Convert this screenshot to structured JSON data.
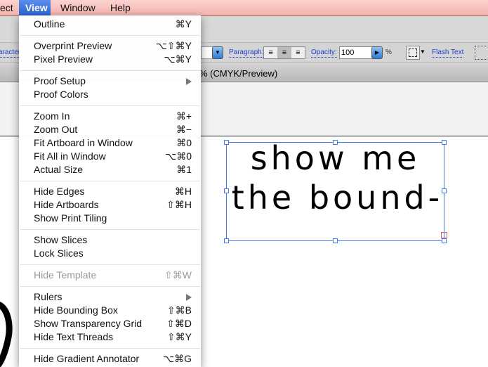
{
  "menubar": {
    "items": [
      "ect",
      "View",
      "Window",
      "Help"
    ],
    "active": "View"
  },
  "controlbar": {
    "character_label": "aracter",
    "paragraph_label": "Paragraph:",
    "opacity_label": "Opacity:",
    "opacity_value": "100",
    "percent": "%",
    "flash_text": "Flash Text"
  },
  "document_tab": {
    "title": "% (CMYK/Preview)"
  },
  "canvas": {
    "text_line1": "show me",
    "text_line2": "the bound-"
  },
  "colors": {
    "accent": "#2c63d6",
    "selection": "#3c7cf0",
    "link": "#1f3fcf"
  },
  "view_menu": {
    "items": [
      {
        "label": "Outline",
        "shortcut": "⌘Y"
      },
      {
        "label": "Overprint Preview",
        "shortcut": "⌥⇧⌘Y"
      },
      {
        "label": "Pixel Preview",
        "shortcut": "⌥⌘Y"
      },
      {
        "label": "Proof Setup",
        "shortcut": "",
        "submenu": true
      },
      {
        "label": "Proof Colors",
        "shortcut": ""
      },
      {
        "label": "Zoom In",
        "shortcut": "⌘+"
      },
      {
        "label": "Zoom Out",
        "shortcut": "⌘−"
      },
      {
        "label": "Fit Artboard in Window",
        "shortcut": "⌘0"
      },
      {
        "label": "Fit All in Window",
        "shortcut": "⌥⌘0"
      },
      {
        "label": "Actual Size",
        "shortcut": "⌘1"
      },
      {
        "label": "Hide Edges",
        "shortcut": "⌘H"
      },
      {
        "label": "Hide Artboards",
        "shortcut": "⇧⌘H"
      },
      {
        "label": "Show Print Tiling",
        "shortcut": ""
      },
      {
        "label": "Show Slices",
        "shortcut": ""
      },
      {
        "label": "Lock Slices",
        "shortcut": ""
      },
      {
        "label": "Hide Template",
        "shortcut": "⇧⌘W",
        "disabled": true
      },
      {
        "label": "Rulers",
        "shortcut": "",
        "submenu": true
      },
      {
        "label": "Hide Bounding Box",
        "shortcut": "⇧⌘B"
      },
      {
        "label": "Show Transparency Grid",
        "shortcut": "⇧⌘D"
      },
      {
        "label": "Hide Text Threads",
        "shortcut": "⇧⌘Y"
      },
      {
        "label": "Hide Gradient Annotator",
        "shortcut": "⌥⌘G"
      }
    ]
  }
}
